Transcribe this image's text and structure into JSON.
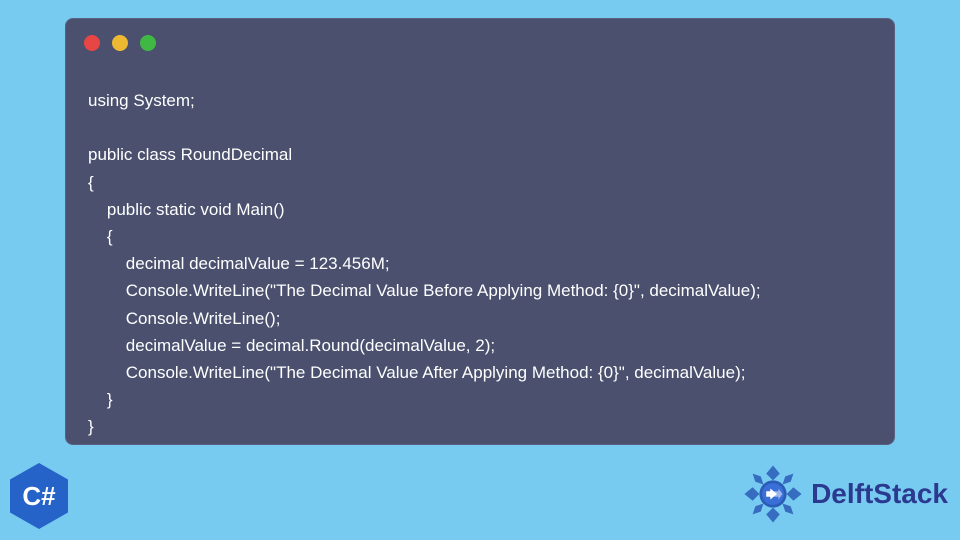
{
  "code": {
    "lines": [
      "using System;",
      "",
      "public class RoundDecimal",
      "{",
      "    public static void Main()",
      "    {",
      "        decimal decimalValue = 123.456M;",
      "        Console.WriteLine(\"The Decimal Value Before Applying Method: {0}\", decimalValue);",
      "        Console.WriteLine();",
      "        decimalValue = decimal.Round(decimalValue, 2);",
      "        Console.WriteLine(\"The Decimal Value After Applying Method: {0}\", decimalValue);",
      "    }",
      "}"
    ]
  },
  "badges": {
    "csharp": "C#",
    "brand_text": "DelftStack"
  },
  "colors": {
    "background": "#77cbf0",
    "window_bg": "#4a506e",
    "light_red": "#e84545",
    "light_yellow": "#eeb932",
    "light_green": "#3fb944",
    "csharp_hex": "#2563c9",
    "brand_text_color": "#2b3a8f"
  }
}
